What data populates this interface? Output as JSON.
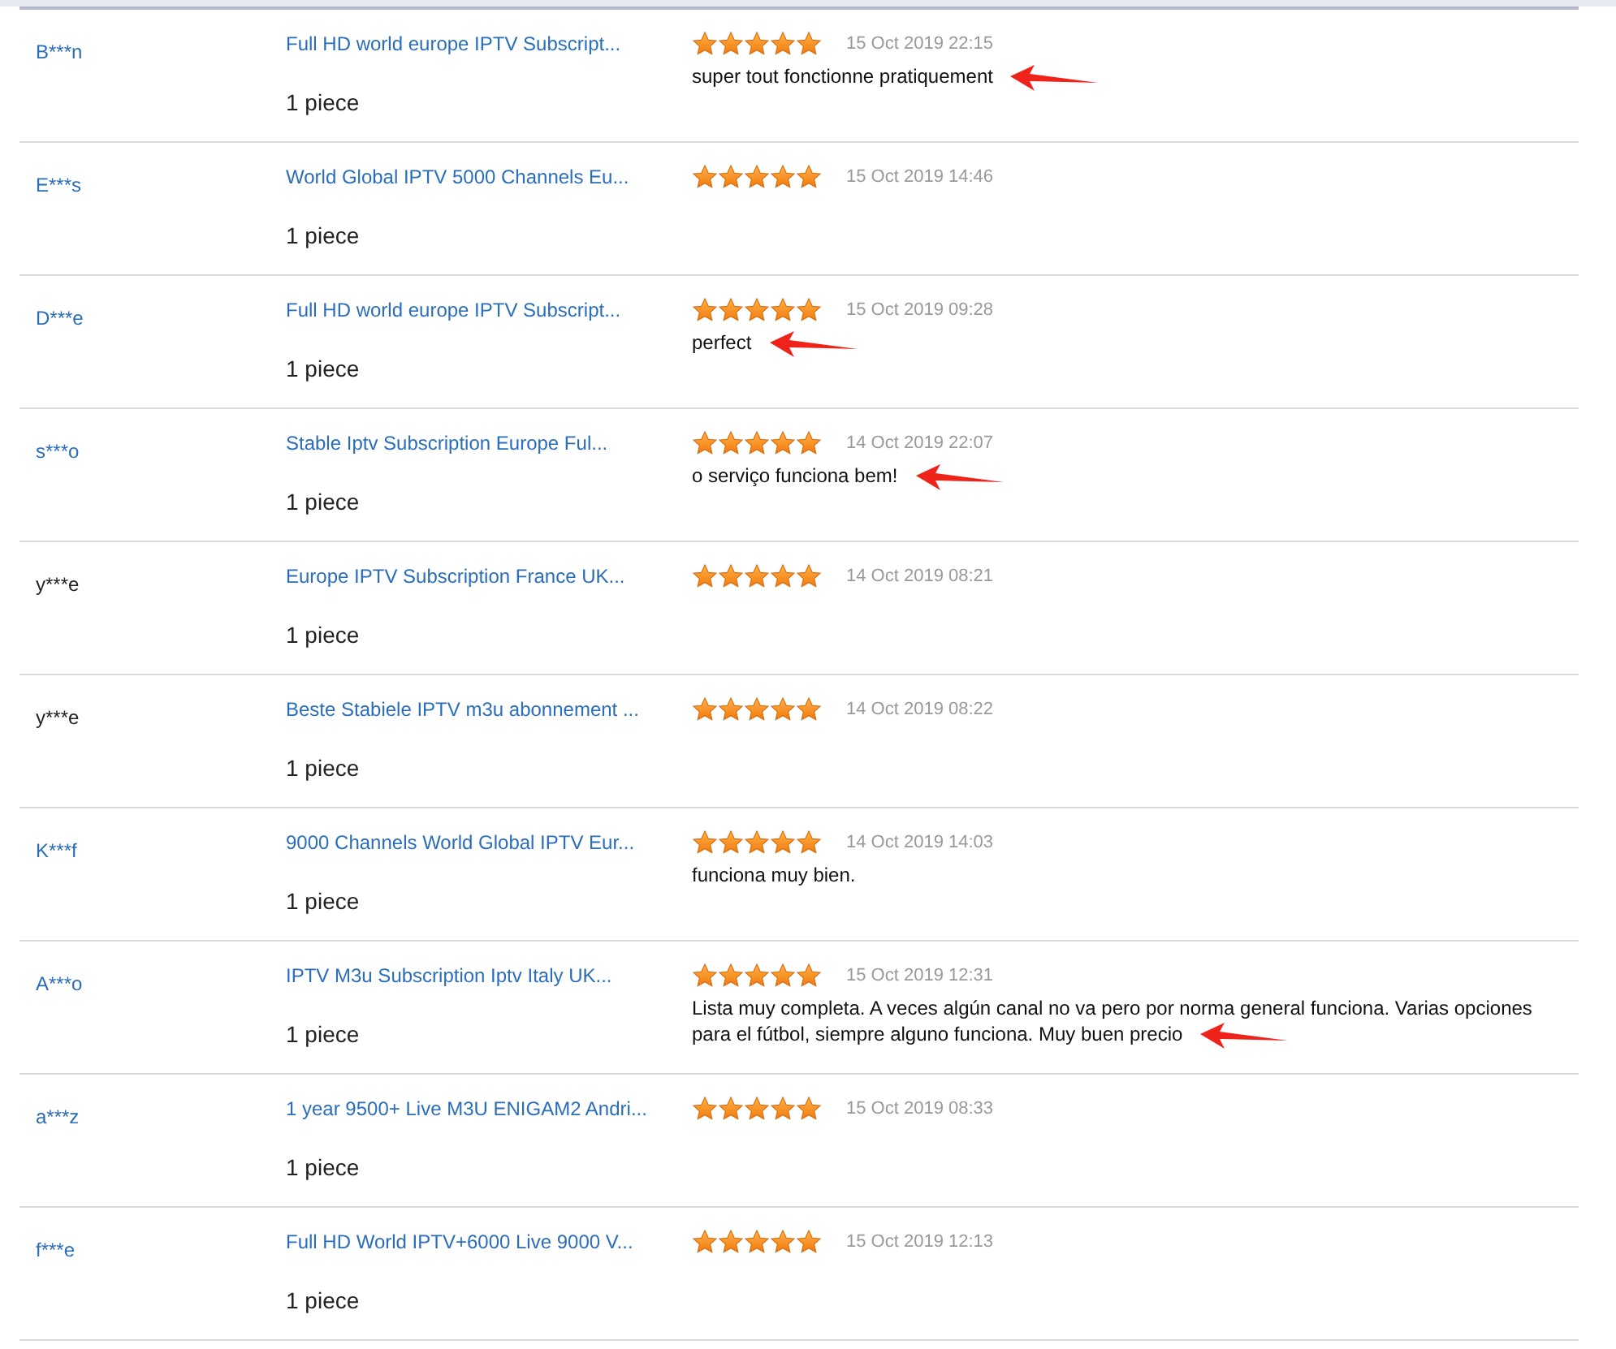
{
  "reviews": [
    {
      "buyer": {
        "name": "B***n",
        "linked": true
      },
      "product": "Full HD world europe IPTV Subscript...",
      "quantity": "1 piece",
      "stars": 5,
      "date": "15 Oct 2019 22:15",
      "comment": "super tout fonctionne pratiquement",
      "arrow": true
    },
    {
      "buyer": {
        "name": "E***s",
        "linked": true
      },
      "product": "World Global IPTV 5000 Channels Eu...",
      "quantity": "1 piece",
      "stars": 5,
      "date": "15 Oct 2019 14:46",
      "arrow": false
    },
    {
      "buyer": {
        "name": "D***e",
        "linked": true
      },
      "product": "Full HD world europe IPTV Subscript...",
      "quantity": "1 piece",
      "stars": 5,
      "date": "15 Oct 2019 09:28",
      "comment": "perfect",
      "arrow": true
    },
    {
      "buyer": {
        "name": "s***o",
        "linked": true
      },
      "product": "Stable Iptv Subscription Europe Ful...",
      "quantity": "1 piece",
      "stars": 5,
      "date": "14 Oct 2019 22:07",
      "comment": "o serviço funciona bem!",
      "arrow": true
    },
    {
      "buyer": {
        "name": "y***e",
        "linked": false
      },
      "product": "Europe IPTV Subscription France UK...",
      "quantity": "1 piece",
      "stars": 5,
      "date": "14 Oct 2019 08:21",
      "arrow": false
    },
    {
      "buyer": {
        "name": "y***e",
        "linked": false
      },
      "product": "Beste Stabiele IPTV m3u abonnement ...",
      "quantity": "1 piece",
      "stars": 5,
      "date": "14 Oct 2019 08:22",
      "arrow": false
    },
    {
      "buyer": {
        "name": "K***f",
        "linked": true
      },
      "product": "9000 Channels World Global IPTV Eur...",
      "quantity": "1 piece",
      "stars": 5,
      "date": "14 Oct 2019 14:03",
      "comment": "funciona muy bien.",
      "arrow": false
    },
    {
      "buyer": {
        "name": "A***o",
        "linked": true
      },
      "product": "IPTV M3u Subscription Iptv Italy UK...",
      "quantity": "1 piece",
      "stars": 5,
      "date": "15 Oct 2019 12:31",
      "comment": "Lista muy completa. A veces algún canal no va pero por norma general funciona. Varias opciones para el fútbol, siempre alguno funciona. Muy buen precio",
      "arrow": true
    },
    {
      "buyer": {
        "name": "a***z",
        "linked": true
      },
      "product": "1 year 9500+ Live M3U ENIGAM2 Andri...",
      "quantity": "1 piece",
      "stars": 5,
      "date": "15 Oct 2019 08:33",
      "arrow": false
    },
    {
      "buyer": {
        "name": "f***e",
        "linked": true
      },
      "product": "Full HD World IPTV+6000 Live 9000 V...",
      "quantity": "1 piece",
      "stars": 5,
      "date": "15 Oct 2019 12:13",
      "arrow": false
    }
  ]
}
